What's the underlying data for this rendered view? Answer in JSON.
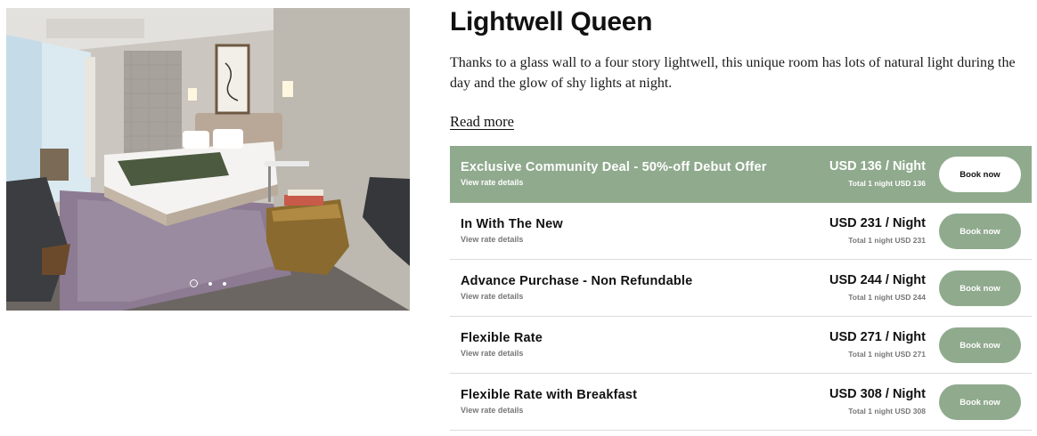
{
  "room": {
    "title": "Lightwell Queen",
    "description": "Thanks to a glass wall to a four story lightwell, this unique room has lots of natural light during the day and the glow of shy lights at night.",
    "read_more": "Read more"
  },
  "carousel": {
    "slide_count": 3,
    "active_slide": 1
  },
  "rates": [
    {
      "name": "Exclusive Community Deal - 50%-off Debut Offer",
      "details_link": "View rate details",
      "price": "USD 136 / Night",
      "total": "Total 1 night USD 136",
      "button": "Book now",
      "featured": true
    },
    {
      "name": "In With The New",
      "details_link": "View rate details",
      "price": "USD 231 / Night",
      "total": "Total 1 night USD 231",
      "button": "Book now",
      "featured": false
    },
    {
      "name": "Advance Purchase - Non Refundable",
      "details_link": "View rate details",
      "price": "USD 244 / Night",
      "total": "Total 1 night USD 244",
      "button": "Book now",
      "featured": false
    },
    {
      "name": "Flexible Rate",
      "details_link": "View rate details",
      "price": "USD 271 / Night",
      "total": "Total 1 night USD 271",
      "button": "Book now",
      "featured": false
    },
    {
      "name": "Flexible Rate with Breakfast",
      "details_link": "View rate details",
      "price": "USD 308 / Night",
      "total": "Total 1 night USD 308",
      "button": "Book now",
      "featured": false
    }
  ],
  "colors": {
    "accent_green": "#90aa8e",
    "text": "#111111",
    "muted": "#777777",
    "divider": "#dcdcdc"
  }
}
